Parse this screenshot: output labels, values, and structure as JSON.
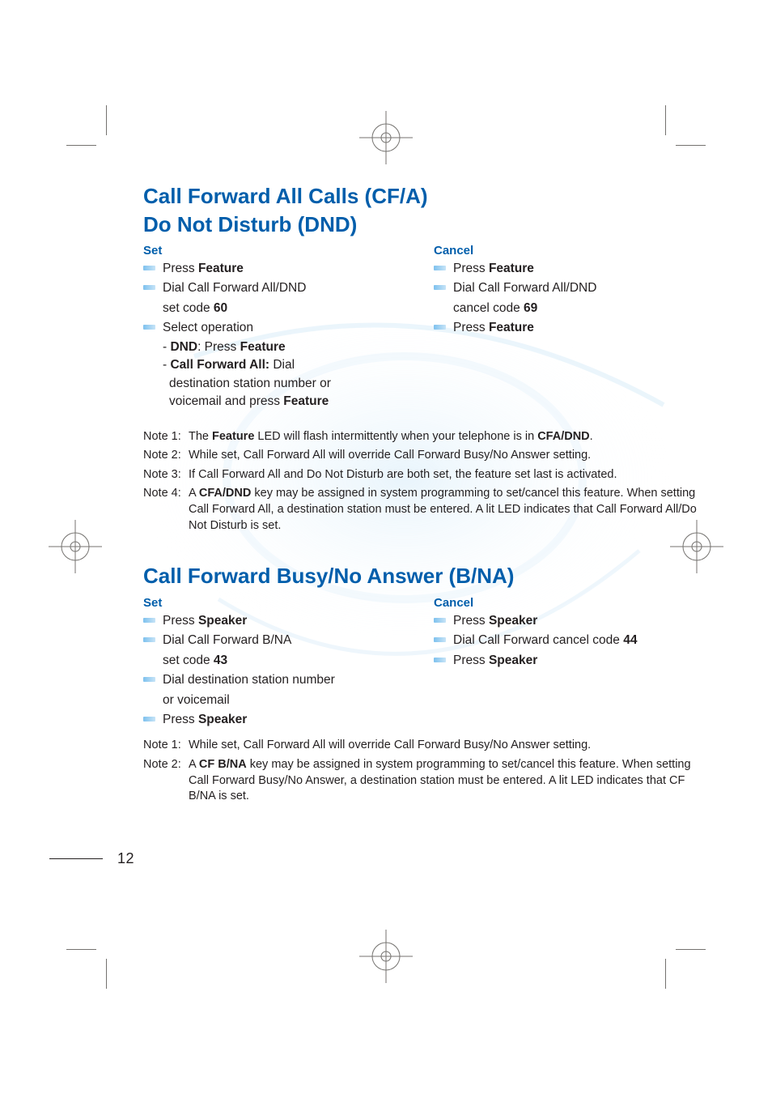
{
  "page_number": "12",
  "section1": {
    "title_line1": "Call Forward All Calls (CF/A)",
    "title_line2": "Do Not Disturb (DND)",
    "set": {
      "heading": "Set",
      "item1_pre": "Press ",
      "item1_b": "Feature",
      "item2_line1": "Dial Call Forward All/DND",
      "item2_line2_pre": "set code ",
      "item2_line2_b": "60",
      "item3": "Select operation",
      "item3_sub1_pre": "- ",
      "item3_sub1_b": "DND",
      "item3_sub1_mid": ":  Press ",
      "item3_sub1_b2": "Feature",
      "item3_sub2_pre": "- ",
      "item3_sub2_b": "Call Forward All:",
      "item3_sub2_rest": " Dial",
      "item3_sub3": "destination station number or",
      "item3_sub4_pre": "voicemail and press ",
      "item3_sub4_b": "Feature"
    },
    "cancel": {
      "heading": "Cancel",
      "item1_pre": "Press ",
      "item1_b": "Feature",
      "item2_line1": "Dial Call Forward All/DND",
      "item2_line2_pre": "cancel code ",
      "item2_line2_b": "69",
      "item3_pre": "Press ",
      "item3_b": "Feature"
    },
    "notes": {
      "n1_label": "Note 1:",
      "n1_pre": "The ",
      "n1_b1": "Feature",
      "n1_mid": " LED will flash intermittently when your telephone is in ",
      "n1_b2": "CFA/DND",
      "n1_post": ".",
      "n2_label": "Note 2:",
      "n2_text": "While set, Call Forward All will override Call Forward Busy/No Answer setting.",
      "n3_label": "Note 3:",
      "n3_text": "If Call Forward All and Do Not Disturb are both set, the feature set last is activated.",
      "n4_label": "Note 4:",
      "n4_pre": "A ",
      "n4_b": "CFA/DND",
      "n4_post": " key may be assigned in system programming to set/cancel this feature.  When setting Call Forward All, a destination station must be entered.  A lit LED indicates that Call Forward All/Do Not Disturb is set."
    }
  },
  "section2": {
    "title": "Call Forward Busy/No Answer (B/NA)",
    "set": {
      "heading": "Set",
      "item1_pre": "Press ",
      "item1_b": "Speaker",
      "item2_line1": "Dial Call Forward B/NA",
      "item2_line2_pre": "set code ",
      "item2_line2_b": "43",
      "item3_line1": "Dial destination station number",
      "item3_line2": "or voicemail",
      "item4_pre": "Press ",
      "item4_b": "Speaker"
    },
    "cancel": {
      "heading": "Cancel",
      "item1_pre": "Press ",
      "item1_b": "Speaker",
      "item2_pre": "Dial Call Forward cancel code ",
      "item2_b": "44",
      "item3_pre": "Press ",
      "item3_b": "Speaker"
    },
    "notes": {
      "n1_label": "Note 1:",
      "n1_text": "While set, Call Forward All will override Call Forward Busy/No Answer setting.",
      "n2_label": "Note 2:",
      "n2_pre": "A ",
      "n2_b": "CF B/NA",
      "n2_post": " key may be assigned in system programming to set/cancel this feature.  When setting Call Forward Busy/No Answer, a destination station must be entered.  A lit LED indicates that CF B/NA is set."
    }
  }
}
